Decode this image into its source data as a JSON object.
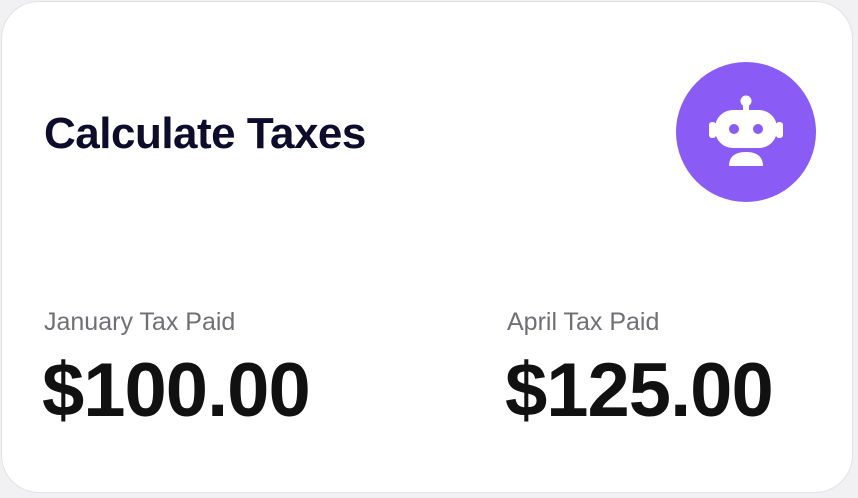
{
  "card": {
    "title": "Calculate Taxes",
    "assistant_icon": "robot-icon",
    "accent_color": "#8a5cf5"
  },
  "stats": [
    {
      "label": "January Tax Paid",
      "value": "$100.00"
    },
    {
      "label": "April Tax Paid",
      "value": "$125.00"
    }
  ]
}
